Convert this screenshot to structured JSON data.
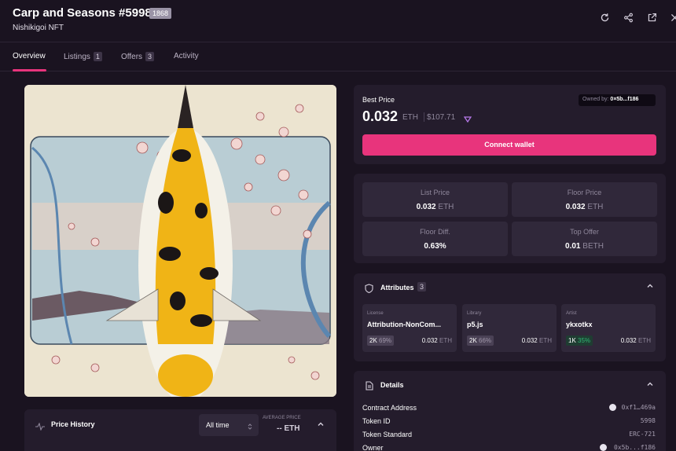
{
  "header": {
    "title": "Carp and Seasons #5998",
    "badge": "1868",
    "subtitle": "Nishikigoi NFT",
    "icons": [
      "refresh-icon",
      "share-icon",
      "external-link-icon",
      "close-icon"
    ]
  },
  "tabs": [
    {
      "label": "Overview"
    },
    {
      "label": "Listings",
      "count": "1"
    },
    {
      "label": "Offers",
      "count": "3"
    },
    {
      "label": "Activity"
    }
  ],
  "price_card": {
    "best_price_label": "Best Price",
    "owned_by_label": "Owned by:",
    "owned_by_value": "0×5b...f186",
    "price": "0.032",
    "currency": "ETH",
    "usd": "$107.71",
    "connect_label": "Connect wallet"
  },
  "stats": [
    {
      "label": "List Price",
      "value": "0.032",
      "unit": "ETH"
    },
    {
      "label": "Floor Price",
      "value": "0.032",
      "unit": "ETH"
    },
    {
      "label": "Floor Diff.",
      "value": "0.63%",
      "unit": ""
    },
    {
      "label": "Top Offer",
      "value": "0.01",
      "unit": "BETH"
    }
  ],
  "attributes": {
    "title": "Attributes",
    "count": "3",
    "items": [
      {
        "type": "License",
        "name": "Attribution-NonCom...",
        "count": "2K",
        "pct": "69%",
        "price": "0.032",
        "unit": "ETH"
      },
      {
        "type": "Library",
        "name": "p5.js",
        "count": "2K",
        "pct": "66%",
        "price": "0.032",
        "unit": "ETH"
      },
      {
        "type": "Artist",
        "name": "ykxotkx",
        "count": "1K",
        "pct": "35%",
        "price": "0.032",
        "unit": "ETH"
      }
    ]
  },
  "details": {
    "title": "Details",
    "rows": [
      {
        "label": "Contract Address",
        "value": "0xf1…469a"
      },
      {
        "label": "Token ID",
        "value": "5998"
      },
      {
        "label": "Token Standard",
        "value": "ERC-721"
      },
      {
        "label": "Owner",
        "value": "0x5b...f186"
      }
    ]
  },
  "price_history": {
    "title": "Price History",
    "range": "All time",
    "avg_label": "AVERAGE PRICE",
    "avg_value": "-- ETH"
  },
  "colors": {
    "accent": "#e8347c",
    "background": "#1a1320",
    "panel": "#241c2c"
  }
}
